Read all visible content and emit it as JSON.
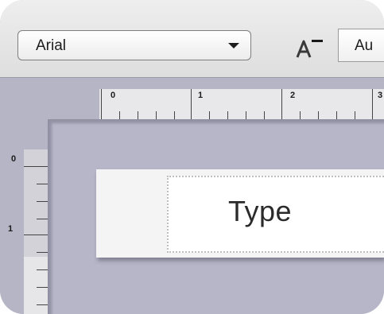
{
  "toolbar": {
    "font_family": "Arial",
    "font_size_icon": "font-size-icon",
    "size_value": "Au"
  },
  "rulers": {
    "horizontal_labels": [
      "0",
      "1",
      "2",
      "3"
    ],
    "vertical_labels": [
      "0",
      "1"
    ]
  },
  "label": {
    "text": "Type"
  },
  "colors": {
    "workspace": "#b5b5c5",
    "toolbar": "#e6e6e6",
    "label_background": "#ffffff"
  }
}
